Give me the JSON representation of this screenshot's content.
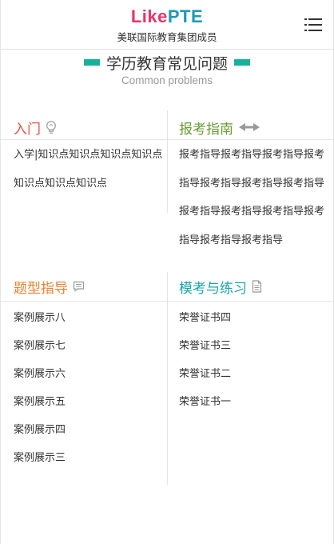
{
  "header": {
    "logo_like": "Like",
    "logo_pte": "PTE",
    "tagline": "美联国际教育集团成员"
  },
  "section": {
    "title_cn": "学历教育常见问题",
    "title_en": "Common problems"
  },
  "categories": {
    "intro": {
      "title": "入门",
      "color": "#e05248",
      "text": "入学|知识点知识点知识点知识点知识点知识点知识点"
    },
    "guide": {
      "title": "报考指南",
      "color": "#6a9a35",
      "text": "报考指导报考指导报考指导报考指导报考指导报考指导报考指导报考指导报考指导报考指导报考指导报考指导报考指导"
    },
    "types": {
      "title": "题型指导",
      "color": "#e8822f",
      "items": [
        "案例展示八",
        "案例展示七",
        "案例展示六",
        "案例展示五",
        "案例展示四",
        "案例展示三"
      ]
    },
    "mock": {
      "title": "模考与练习",
      "color": "#1aa5a6",
      "items": [
        "荣誉证书四",
        "荣誉证书三",
        "荣誉证书二",
        "荣誉证书一"
      ]
    }
  },
  "colors": {
    "accent_bar": "#17b19b",
    "logo_like": "#e8336b",
    "logo_pte": "#1a9bb8"
  }
}
